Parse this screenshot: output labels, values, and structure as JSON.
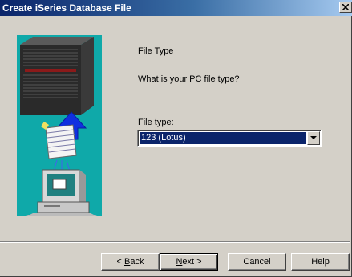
{
  "window": {
    "title": "Create iSeries Database File"
  },
  "page": {
    "heading": "File Type",
    "question": "What is your PC file type?",
    "file_type_label_mnemonic": "F",
    "file_type_label_rest": "ile type:",
    "file_type_value": "123 (Lotus)"
  },
  "buttons": {
    "back_prefix": "< ",
    "back_mnemonic": "B",
    "back_rest": "ack",
    "next_mnemonic": "N",
    "next_rest": "ext >",
    "cancel": "Cancel",
    "help": "Help"
  },
  "colors": {
    "titlebar_start": "#0a246a",
    "titlebar_end": "#a6caf0",
    "illustration_bg": "#0fa9a9",
    "selection_bg": "#0a246a",
    "dialog_bg": "#d4d0c8"
  },
  "icons": [
    "close-icon",
    "dropdown-arrow-icon",
    "server-icon",
    "upload-arrow-icon",
    "spreadsheet-icon",
    "pc-icon"
  ]
}
